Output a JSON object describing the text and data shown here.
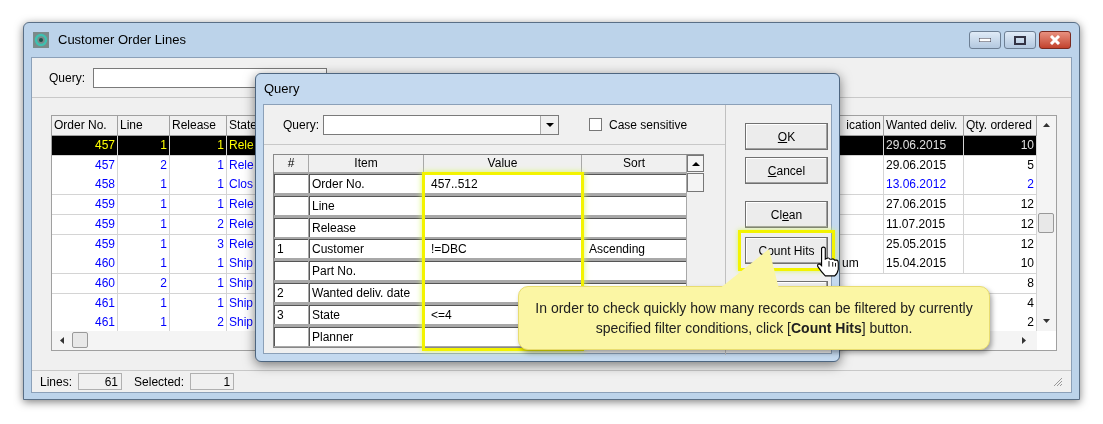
{
  "window": {
    "title": "Customer Order Lines",
    "query_label": "Query:"
  },
  "table": {
    "columns": [
      "Order No.",
      "Line",
      "Release",
      "State",
      "ication",
      "Wanted deliv.",
      "Qty. ordered"
    ],
    "rows": [
      {
        "selected": true,
        "order_no": "457",
        "line": "1",
        "release": "1",
        "state": "Rele",
        "wanted_deliv": "29.06.2015",
        "qty_ordered": "10"
      },
      {
        "selected": false,
        "color": "#000000",
        "order_no": "457",
        "line": "2",
        "release": "1",
        "state": "Rele",
        "wanted_deliv": "29.06.2015",
        "qty_ordered": "5"
      },
      {
        "selected": false,
        "color": "#0000ff",
        "order_no": "458",
        "line": "1",
        "release": "1",
        "state": "Clos",
        "wanted_deliv": "13.06.2012",
        "qty_ordered": "2"
      },
      {
        "selected": false,
        "color": "#000000",
        "order_no": "459",
        "line": "1",
        "release": "1",
        "state": "Rele",
        "wanted_deliv": "27.06.2015",
        "qty_ordered": "12"
      },
      {
        "selected": false,
        "color": "#000000",
        "order_no": "459",
        "line": "1",
        "release": "2",
        "state": "Rele",
        "wanted_deliv": "11.07.2015",
        "qty_ordered": "12"
      },
      {
        "selected": false,
        "color": "#000000",
        "order_no": "459",
        "line": "1",
        "release": "3",
        "state": "Rele",
        "wanted_deliv": "25.05.2015",
        "qty_ordered": "12"
      },
      {
        "selected": false,
        "color": "#000000",
        "order_no": "460",
        "line": "1",
        "release": "1",
        "state": "Ship",
        "column_5": "um",
        "wanted_deliv": "15.04.2015",
        "qty_ordered": "10"
      },
      {
        "selected": false,
        "color": "#000000",
        "order_no": "460",
        "line": "2",
        "release": "1",
        "state": "Ship",
        "qty_ordered": "8"
      },
      {
        "selected": false,
        "color": "#000000",
        "order_no": "461",
        "line": "1",
        "release": "1",
        "state": "Ship",
        "qty_ordered": "4"
      },
      {
        "selected": false,
        "color": "#000000",
        "order_no": "461",
        "line": "1",
        "release": "2",
        "state": "Ship",
        "qty_ordered": "2"
      }
    ]
  },
  "status_bar": {
    "lines_label": "Lines:",
    "lines": "61",
    "selected_label": "Selected:",
    "selected_count": "1"
  },
  "query_dialog": {
    "title": "Query",
    "query_label": "Query:",
    "case_sensitive": {
      "label": "Case sensitive",
      "checked": false
    },
    "columns": [
      "#",
      "Item",
      "Value",
      "Sort"
    ],
    "value_column_highlighted": true,
    "rows": [
      {
        "item": "Order No.",
        "value": "457..512"
      },
      {
        "item": "Line"
      },
      {
        "item": "Release"
      },
      {
        "index": "1",
        "item": "Customer",
        "value": "!=DBC",
        "sort": "Ascending"
      },
      {
        "item": "Part No."
      },
      {
        "index": "2",
        "item": "Wanted deliv. date"
      },
      {
        "index": "3",
        "item": "State",
        "value": "<=4"
      },
      {
        "item": "Planner"
      }
    ],
    "buttons": [
      {
        "mnemonic": "O",
        "label_after": "K",
        "highlighted": false
      },
      {
        "mnemonic": "C",
        "label_after": "ancel",
        "highlighted": false
      },
      {
        "label_before": "Cl",
        "mnemonic": "e",
        "label_after": "an",
        "highlighted": false
      },
      {
        "label_before": "Count Hits",
        "highlighted": true
      },
      {
        "highlighted": false
      }
    ]
  },
  "callout": {
    "text": "In order to check quickly how many records can be filtered by currently specified filter conditions, click [**Count Hits**] button."
  }
}
